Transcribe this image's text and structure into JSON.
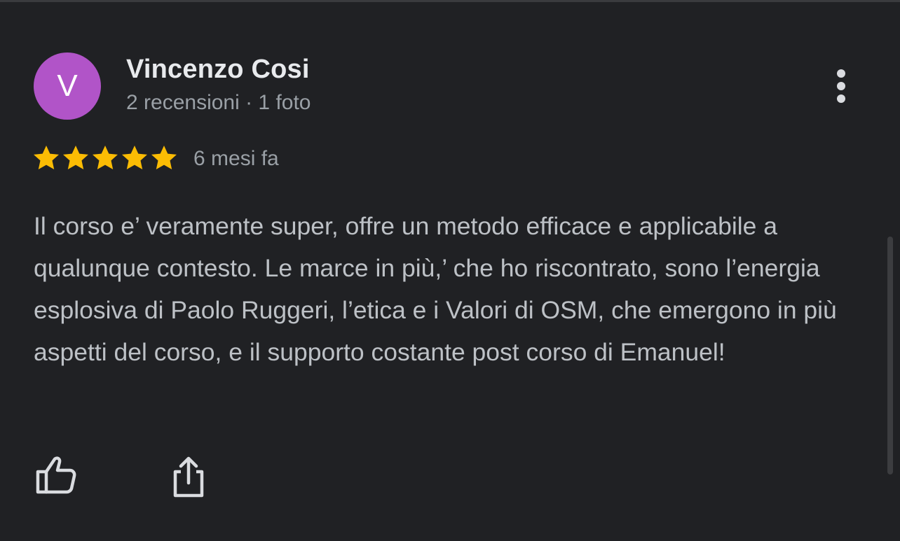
{
  "review": {
    "author": {
      "initial": "V",
      "name": "Vincenzo Cosi",
      "meta": "2 recensioni · 1 foto",
      "avatar_color": "#b154c8"
    },
    "rating": 5,
    "rating_max": 5,
    "star_color": "#fbbc04",
    "time": "6 mesi fa",
    "text": "Il corso e’ veramente super, offre un metodo efficace e applicabile a qualunque contesto. Le marce in più,’ che ho riscontrato, sono l’energia esplosiva di Paolo Ruggeri, l’etica e i Valori di OSM, che emergono in più aspetti del corso, e il supporto costante post corso di Emanuel!",
    "icons": {
      "more": "more-vert-icon",
      "like": "thumb-up-icon",
      "share": "share-icon"
    }
  },
  "theme": {
    "background": "#202124",
    "primary_text": "#e8eaed",
    "secondary_text": "#9aa0a6",
    "body_text": "#bdc1c6"
  }
}
